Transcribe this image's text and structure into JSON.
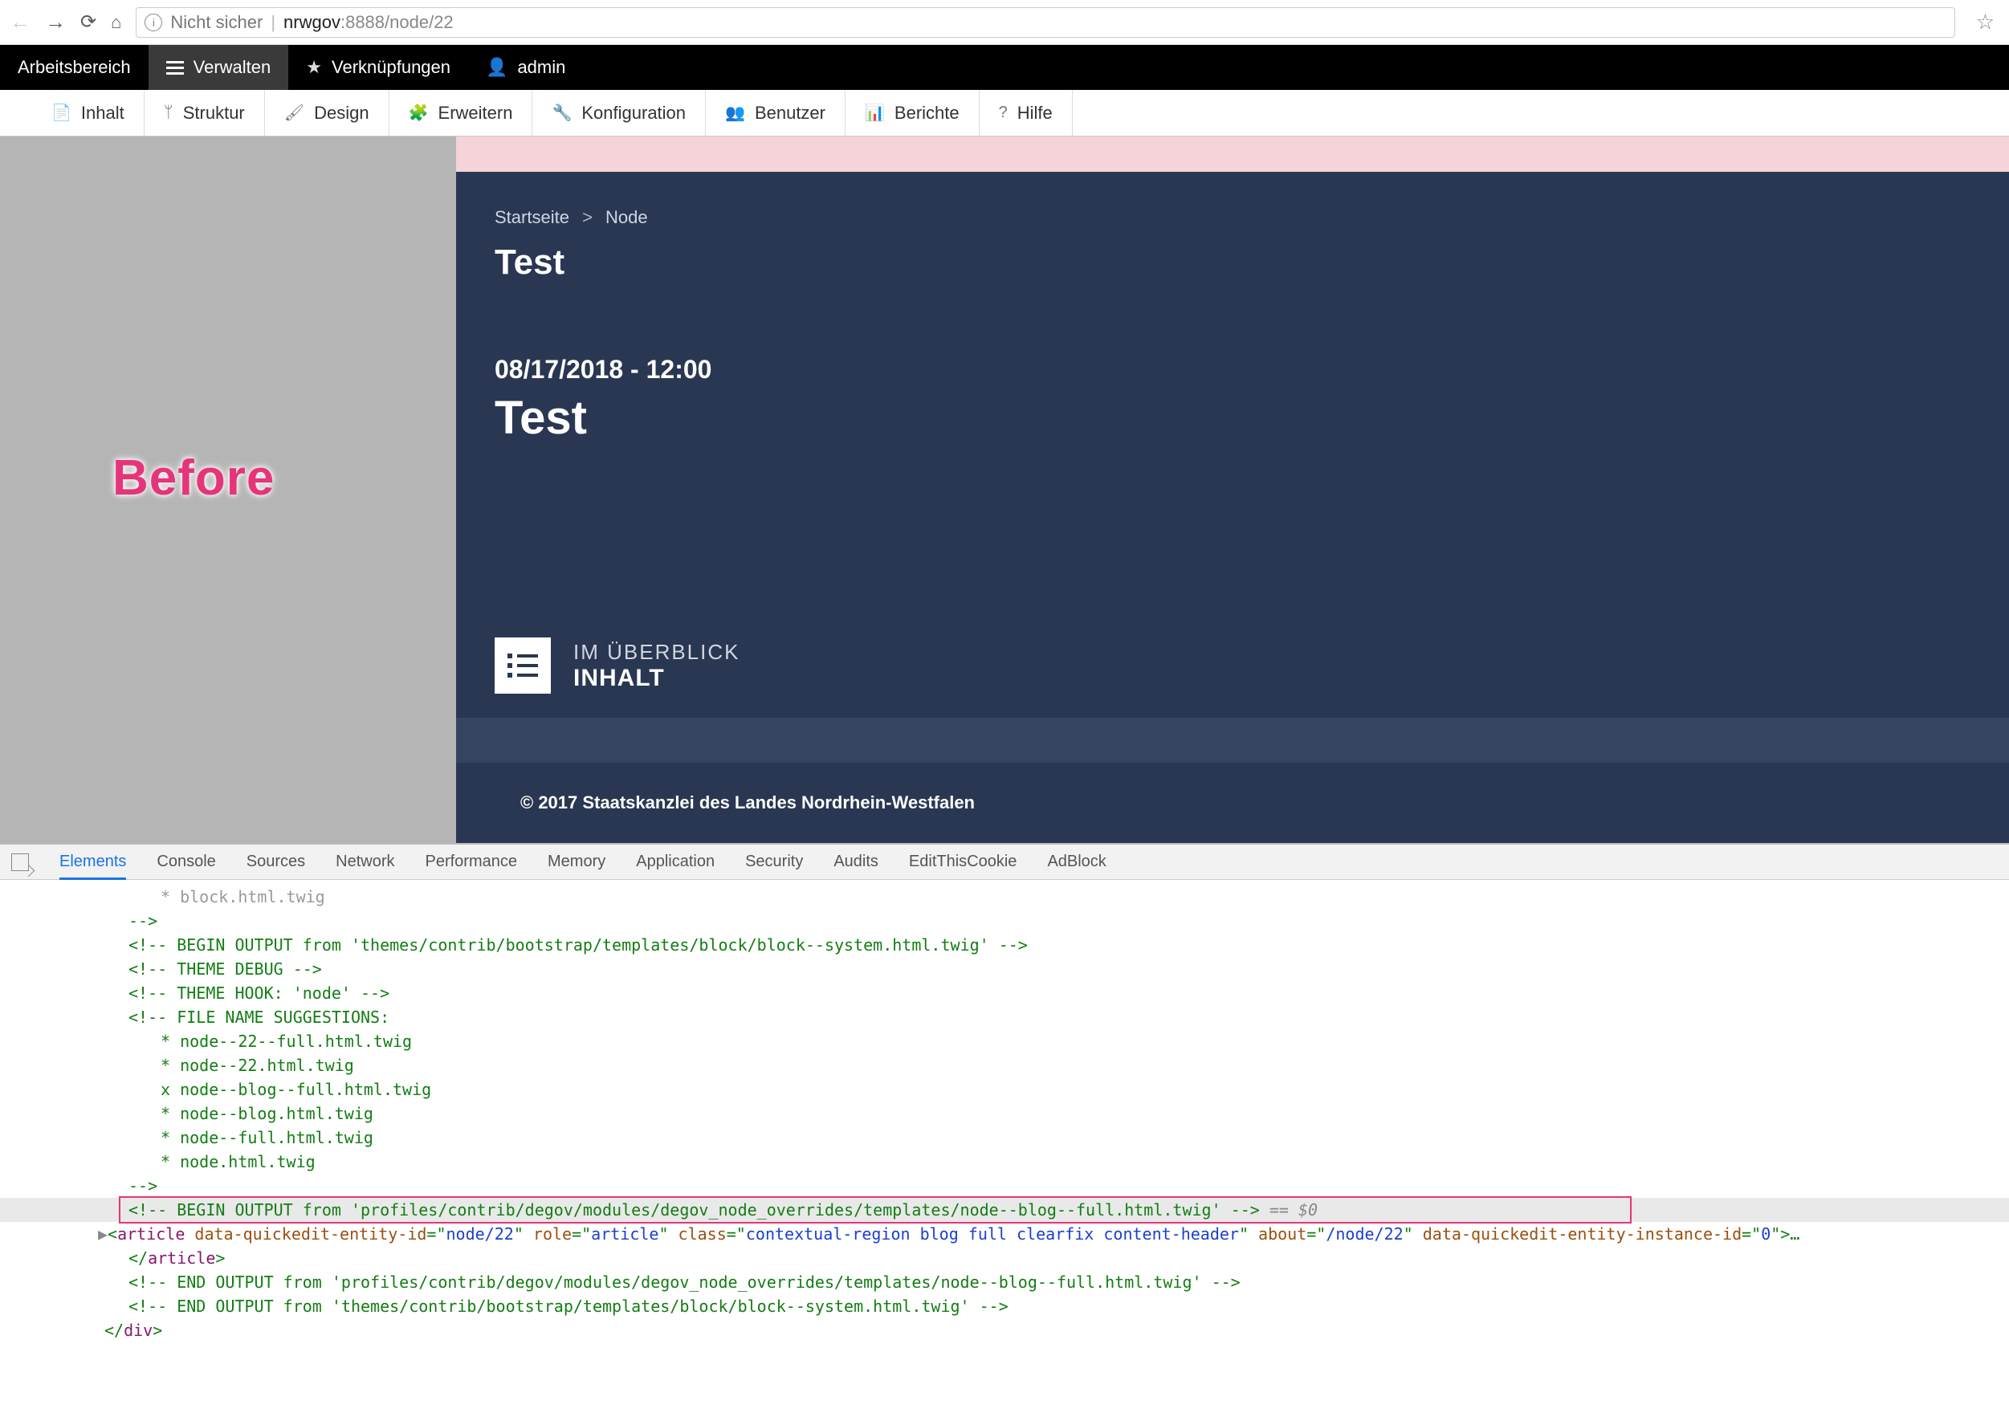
{
  "browser": {
    "insecure_label": "Nicht sicher",
    "host": "nrwgov",
    "port": ":8888",
    "path": "/node/22"
  },
  "admin_bar": {
    "workspace": "Arbeitsbereich",
    "manage": "Verwalten",
    "shortcuts": "Verknüpfungen",
    "user": "admin"
  },
  "toolbar": {
    "content": "Inhalt",
    "structure": "Struktur",
    "design": "Design",
    "extend": "Erweitern",
    "config": "Konfiguration",
    "users": "Benutzer",
    "reports": "Berichte",
    "help": "Hilfe"
  },
  "annotation": {
    "before": "Before"
  },
  "page": {
    "breadcrumb": {
      "home": "Startseite",
      "node": "Node"
    },
    "title1": "Test",
    "date": "08/17/2018 - 12:00",
    "title2": "Test",
    "overview_top": "IM ÜBERBLICK",
    "overview_bottom": "INHALT",
    "footer": "© 2017 Staatskanzlei des Landes Nordrhein-Westfalen"
  },
  "devtools": {
    "tabs": [
      "Elements",
      "Console",
      "Sources",
      "Network",
      "Performance",
      "Memory",
      "Application",
      "Security",
      "Audits",
      "EditThisCookie",
      "AdBlock"
    ],
    "lines": {
      "l0": "   * block.html.twig",
      "l1": "-->",
      "l2": "<!-- BEGIN OUTPUT from 'themes/contrib/bootstrap/templates/block/block--system.html.twig' -->",
      "l3": "<!-- THEME DEBUG -->",
      "l4": "<!-- THEME HOOK: 'node' -->",
      "l5": "<!-- FILE NAME SUGGESTIONS:",
      "l6": "   * node--22--full.html.twig",
      "l7": "   * node--22.html.twig",
      "l8": "   x node--blog--full.html.twig",
      "l9": "   * node--blog.html.twig",
      "l10": "   * node--full.html.twig",
      "l11": "   * node.html.twig",
      "l12": "-->",
      "l13a": "<!-- BEGIN OUTPUT from 'profiles/contrib/degov/modules/degov_node_overrides/templates/node--blog--full.html.twig' -->",
      "l13b": " == ",
      "l13c": "$0",
      "end1": "<!-- END OUTPUT from 'profiles/contrib/degov/modules/degov_node_overrides/templates/node--blog--full.html.twig' -->",
      "end2": "<!-- END OUTPUT from 'themes/contrib/bootstrap/templates/block/block--system.html.twig' -->",
      "article_open_1": "article",
      "article_attr1n": " data-quickedit-entity-id",
      "article_attr1v": "node/22",
      "article_attr2n": " role",
      "article_attr2v": "article",
      "article_attr3n": " class",
      "article_attr3v": "contextual-region blog full clearfix content-header",
      "article_attr4n": " about",
      "article_attr4v": "/node/22",
      "article_attr5n": " data-quickedit-entity-instance-id",
      "article_attr5v": "0",
      "article_close": "article",
      "div_close": "div"
    }
  }
}
